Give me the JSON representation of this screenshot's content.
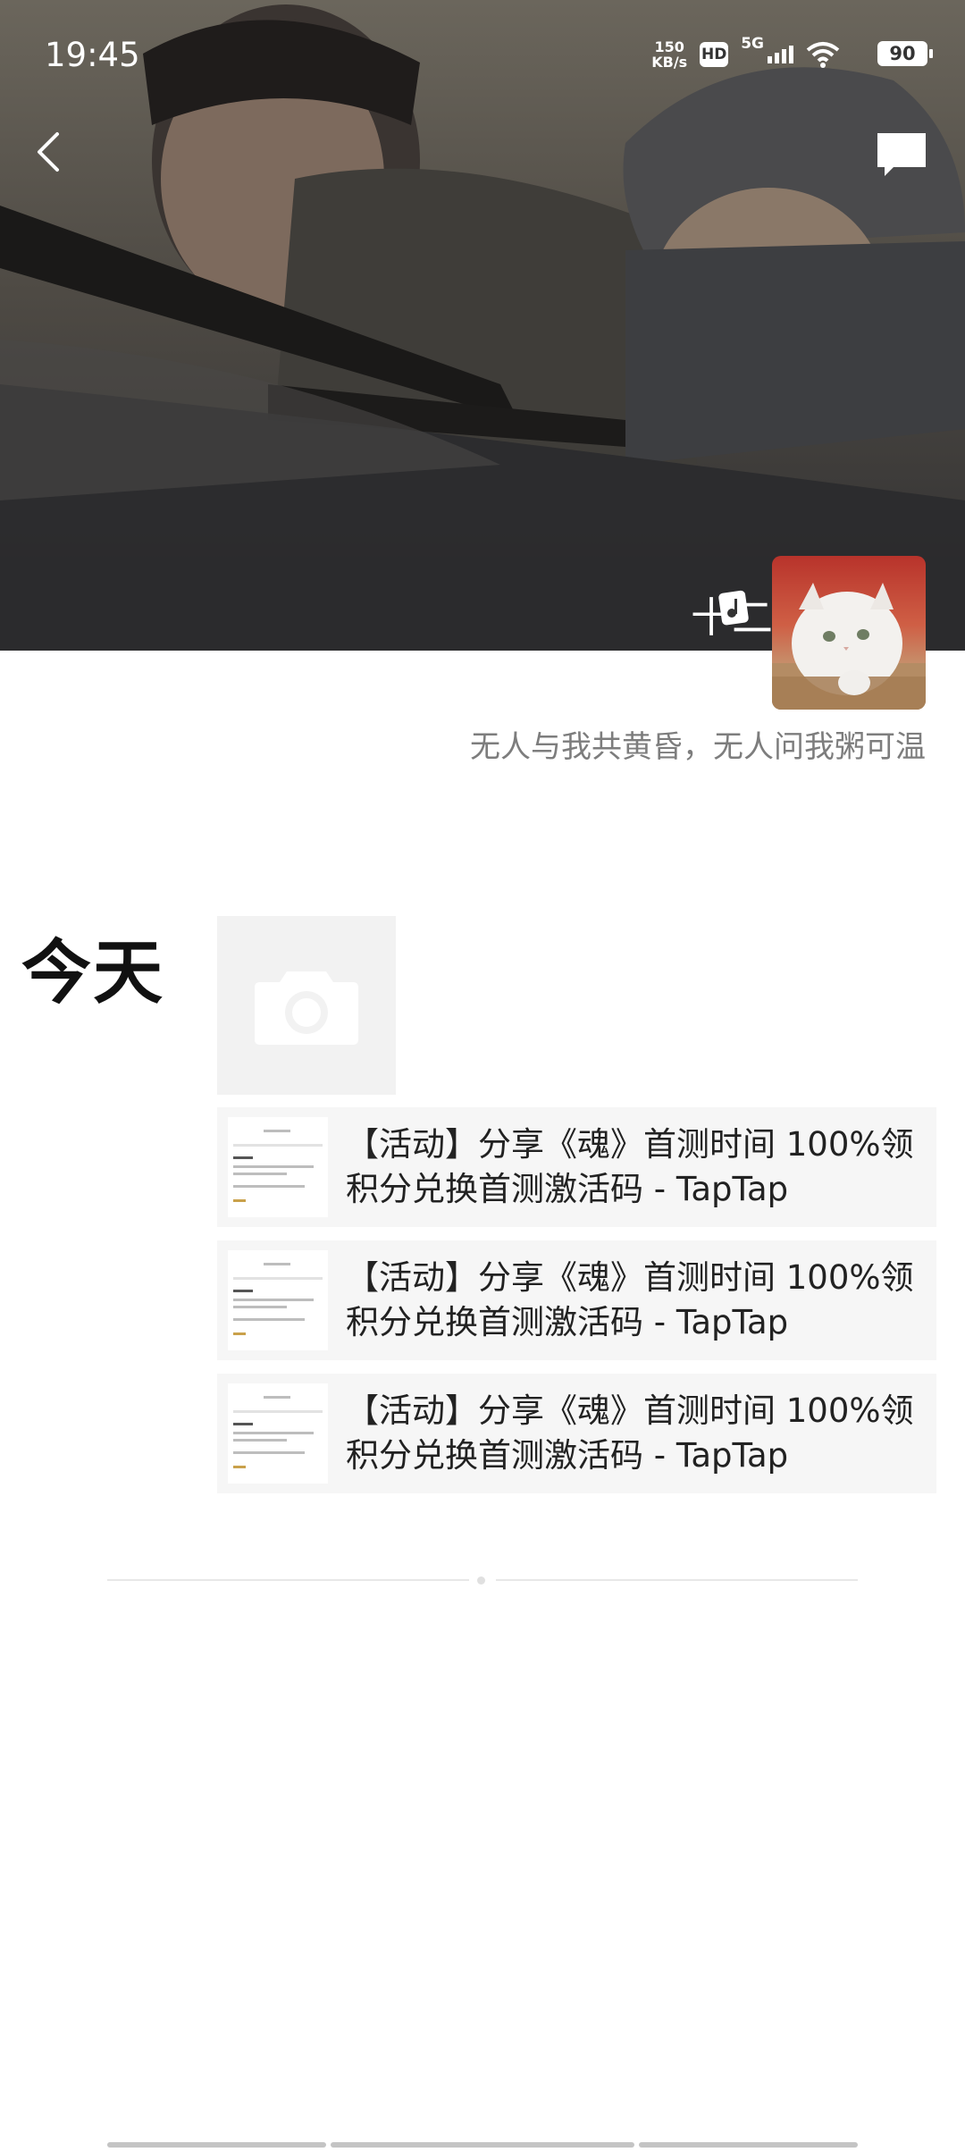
{
  "status_bar": {
    "time": "19:45",
    "network_speed_value": "150",
    "network_speed_unit": "KB/s",
    "hd_label": "HD",
    "signal_label": "5G",
    "battery": "90"
  },
  "header": {
    "user_name": "十二",
    "signature": "无人与我共黄昏，无人问我粥可温"
  },
  "timeline": {
    "date_label": "今天",
    "posts": [
      {
        "title": "【活动】分享《魂》首测时间 100%领积分兑换首测激活码 - TapTap"
      },
      {
        "title": "【活动】分享《魂》首测时间 100%领积分兑换首测激活码 - TapTap"
      },
      {
        "title": "【活动】分享《魂》首测时间 100%领积分兑换首测激活码 - TapTap"
      }
    ]
  },
  "icons": {
    "back": "chevron-left-icon",
    "comment": "comment-icon",
    "music": "music-note-icon",
    "camera": "camera-icon"
  },
  "colors": {
    "cover_dark": "#3c3b39",
    "signature_gray": "#7d7d7d",
    "card_bg": "#f6f6f6"
  }
}
